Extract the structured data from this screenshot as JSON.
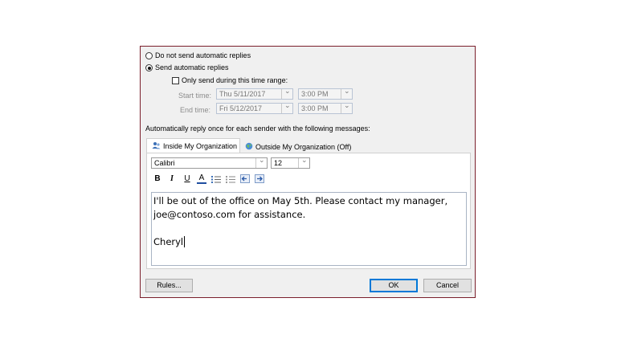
{
  "radio_options": {
    "do_not_send": "Do not send automatic replies",
    "send": "Send automatic replies",
    "selected": "send"
  },
  "time_range": {
    "checkbox_label": "Only send during this time range:",
    "checked": false,
    "start_label": "Start time:",
    "start_date": "Thu 5/11/2017",
    "start_time": "3:00 PM",
    "end_label": "End time:",
    "end_date": "Fri 5/12/2017",
    "end_time": "3:00 PM"
  },
  "instruction": "Automatically reply once for each sender with the following messages:",
  "tabs": [
    {
      "label": "Inside My Organization",
      "active": true,
      "icon": "people-icon"
    },
    {
      "label": "Outside My Organization (Off)",
      "active": false,
      "icon": "globe-icon"
    }
  ],
  "format_bar": {
    "font": "Calibri",
    "size": "12",
    "bold": "B",
    "italic": "I",
    "underline": "U",
    "font_color": "A",
    "font_color_value": "#1f4ea0"
  },
  "message": {
    "line1": "I'll be out of the office on May 5th. Please contact my manager,",
    "line2": "joe@contoso.com for assistance.",
    "line3": "",
    "line4": "Cheryl"
  },
  "buttons": {
    "rules": "Rules...",
    "ok": "OK",
    "cancel": "Cancel"
  },
  "colors": {
    "dialog_border": "#7a1f2b",
    "ok_border": "#0078d7"
  }
}
